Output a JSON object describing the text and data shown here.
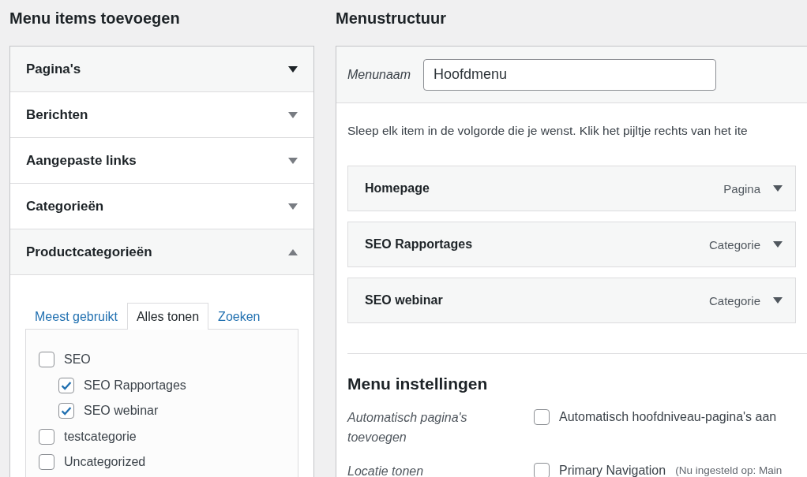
{
  "left": {
    "title": "Menu items toevoegen",
    "sections": [
      {
        "label": "Pagina's",
        "expanded": false,
        "hovered": true
      },
      {
        "label": "Berichten",
        "expanded": false,
        "hovered": false
      },
      {
        "label": "Aangepaste links",
        "expanded": false,
        "hovered": false
      },
      {
        "label": "Categorieën",
        "expanded": false,
        "hovered": false
      },
      {
        "label": "Productcategorieën",
        "expanded": true,
        "hovered": false
      }
    ],
    "tabs": [
      {
        "label": "Meest gebruikt",
        "selected": false
      },
      {
        "label": "Alles tonen",
        "selected": true
      },
      {
        "label": "Zoeken",
        "selected": false
      }
    ],
    "categories": [
      {
        "label": "SEO",
        "checked": false,
        "children": [
          {
            "label": "SEO Rapportages",
            "checked": true
          },
          {
            "label": "SEO webinar",
            "checked": true
          }
        ]
      },
      {
        "label": "testcategorie",
        "checked": false
      },
      {
        "label": "Uncategorized",
        "checked": false
      }
    ]
  },
  "right": {
    "title": "Menustructuur",
    "name_label": "Menunaam",
    "name_value": "Hoofdmenu",
    "instructions": "Sleep elk item in de volgorde die je wenst. Klik het pijltje rechts van het ite",
    "items": [
      {
        "title": "Homepage",
        "type": "Pagina"
      },
      {
        "title": "SEO Rapportages",
        "type": "Categorie"
      },
      {
        "title": "SEO webinar",
        "type": "Categorie"
      }
    ],
    "settings_title": "Menu instellingen",
    "settings": [
      {
        "label": "Automatisch pagina's toevoegen",
        "option": "Automatisch hoofdniveau-pagina's aan",
        "checked": false
      },
      {
        "label": "Locatie tonen",
        "option": "Primary Navigation",
        "note": "(Nu ingesteld op: Main",
        "checked": false
      }
    ]
  }
}
